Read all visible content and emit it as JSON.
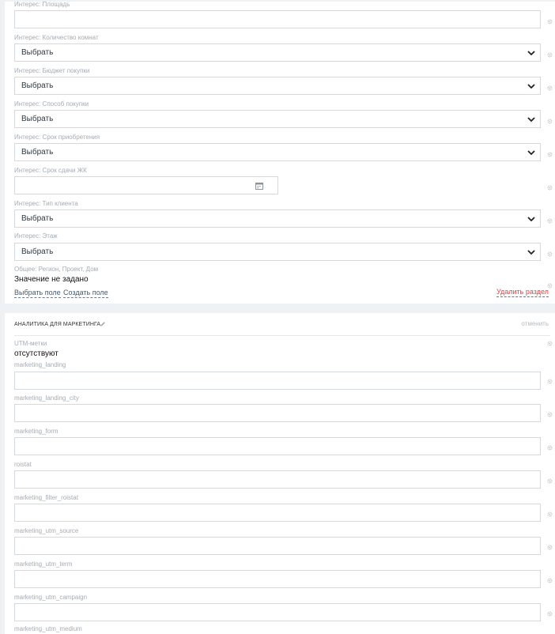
{
  "section1": {
    "fields": [
      {
        "label": "Интерес: Площадь",
        "type": "text"
      },
      {
        "label": "Интерес: Количество комнат",
        "type": "select",
        "value": "Выбрать"
      },
      {
        "label": "Интерес: Бюджет покупки",
        "type": "select",
        "value": "Выбрать"
      },
      {
        "label": "Интерес: Способ покупки",
        "type": "select",
        "value": "Выбрать"
      },
      {
        "label": "Интерес: Срок приобретения",
        "type": "select",
        "value": "Выбрать"
      },
      {
        "label": "Интерес: Срок сдачи ЖК",
        "type": "date"
      },
      {
        "label": "Интерес: Тип клиента",
        "type": "select",
        "value": "Выбрать"
      },
      {
        "label": "Интерес: Этаж",
        "type": "select",
        "value": "Выбрать"
      }
    ],
    "general_label": "Общее: Регион, Проект, Дом",
    "general_value": "Значение не задано",
    "actions": {
      "select_field": "Выбрать поле",
      "create_field": "Создать поле",
      "delete_section": "Удалить раздел"
    }
  },
  "section2": {
    "title": "АНАЛИТИКА ДЛЯ МАРКЕТИНГА",
    "cancel": "отменить",
    "utm_label": "UTM-метки",
    "utm_value": "отсутствуют",
    "fields": [
      {
        "label": "marketing_landing"
      },
      {
        "label": "marketing_landing_city"
      },
      {
        "label": "marketing_form"
      },
      {
        "label": "roistat"
      },
      {
        "label": "marketing_filter_roistat"
      },
      {
        "label": "marketing_utm_source"
      },
      {
        "label": "marketing_utm_term"
      },
      {
        "label": "marketing_utm_campaign"
      },
      {
        "label": "marketing_utm_medium"
      }
    ]
  },
  "icons": {
    "gear": "gear-icon",
    "chevron": "chevron-down-icon",
    "calendar": "calendar-icon",
    "pencil": "pencil-icon"
  },
  "colors": {
    "danger": "#e5413f",
    "label": "#a3acb4",
    "border": "#d3d9de"
  }
}
